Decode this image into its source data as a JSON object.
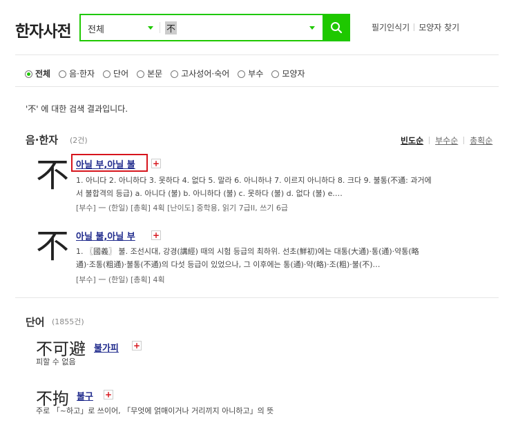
{
  "header": {
    "logo": "한자사전",
    "search_scope": "전체",
    "query": "不",
    "links": [
      "필기인식기",
      "모양자 찾기"
    ]
  },
  "filters": [
    {
      "label": "전체",
      "selected": true
    },
    {
      "label": "음·한자",
      "selected": false
    },
    {
      "label": "단어",
      "selected": false
    },
    {
      "label": "본문",
      "selected": false
    },
    {
      "label": "고사성어·숙어",
      "selected": false
    },
    {
      "label": "부수",
      "selected": false
    },
    {
      "label": "모양자",
      "selected": false
    }
  ],
  "result_message": "'不' 에 대한 검색 결과입니다.",
  "eum_section": {
    "title": "음·한자",
    "count": "(2건)",
    "sort_options": [
      "빈도순",
      "부수순",
      "총획순"
    ],
    "entries": [
      {
        "char": "不",
        "title": "아닐 부,아닐 불",
        "desc_line1": "1. 아니다 2. 아니하다 3. 못하다 4. 없다 5. 말라 6. 아니하냐 7. 이르지 아니하다 8. 크다 9. 불통(不通: 과거에",
        "desc_line2": "서 불합격의 등급) a. 아니다 (불) b. 아니하다 (불) c. 못하다 (불) d. 없다 (불) e.…",
        "meta": "[부수] 一 (한일)  [총획] 4획  [난이도] 중학용, 읽기 7급II, 쓰기 6급"
      },
      {
        "char": "不",
        "title": "아닐 불,아닐 부",
        "desc_line1": "1. 〖國義〗 불. 조선시대, 강경(講經) 때의 시험 등급의 최하위. 선초(鮮初)에는 대통(大通)·통(通)·약통(略",
        "desc_line2": "通)·조통(粗通)·불통(不通)의 다섯 등급이 있었으나, 그 이후에는 통(通)·약(略)·조(粗)·불(不)…",
        "meta": "[부수] 一 (한일)  [총획] 4획"
      }
    ]
  },
  "word_section": {
    "title": "단어",
    "count": "(1855건)",
    "entries": [
      {
        "hanja": "不可避",
        "reading": "불가피",
        "definition": "피할 수 없음"
      },
      {
        "hanja": "不拘",
        "reading": "불구",
        "definition": "주로 「~하고」로 쓰이어, 「무엇에 얽매이거나 거리끼지 아니하고」의 뜻"
      }
    ]
  },
  "colors": {
    "accent": "#1ec800",
    "link": "#1f2a8c",
    "highlight": "#d6141c"
  }
}
